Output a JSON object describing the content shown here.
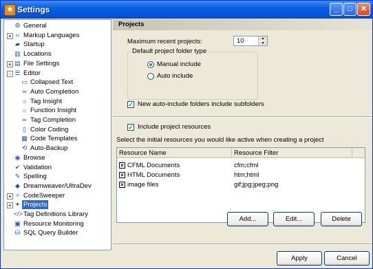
{
  "window": {
    "title": "Settings"
  },
  "tree": {
    "items": [
      {
        "label": "General",
        "icon": "settings-icon",
        "expander": ""
      },
      {
        "label": "Markup Languages",
        "icon": "code-icon",
        "expander": "+"
      },
      {
        "label": "Startup",
        "icon": "folder-icon",
        "expander": ""
      },
      {
        "label": "Locations",
        "icon": "book-icon",
        "expander": ""
      },
      {
        "label": "File Settings",
        "icon": "file-icon",
        "expander": "+"
      },
      {
        "label": "Editor",
        "icon": "editor-icon",
        "expander": "-"
      },
      {
        "label": "Collapsed Text",
        "icon": "collapse-icon",
        "expander": ""
      },
      {
        "label": "Auto Completion",
        "icon": "glasses-icon",
        "expander": ""
      },
      {
        "label": "Tag Insight",
        "icon": "bulb-icon",
        "expander": ""
      },
      {
        "label": "Function Insight",
        "icon": "bulb-icon",
        "expander": ""
      },
      {
        "label": "Tag Completion",
        "icon": "glasses-icon",
        "expander": ""
      },
      {
        "label": "Color Coding",
        "icon": "document-icon",
        "expander": ""
      },
      {
        "label": "Code Templates",
        "icon": "template-icon",
        "expander": ""
      },
      {
        "label": "Auto-Backup",
        "icon": "backup-icon",
        "expander": ""
      },
      {
        "label": "Browse",
        "icon": "browse-icon",
        "expander": ""
      },
      {
        "label": "Validation",
        "icon": "validation-icon",
        "expander": ""
      },
      {
        "label": "Spelling",
        "icon": "spelling-icon",
        "expander": ""
      },
      {
        "label": "Dreamweaver/UltraDev",
        "icon": "dreamweaver-icon",
        "expander": ""
      },
      {
        "label": "CodeSweeper",
        "icon": "broom-icon",
        "expander": "+"
      },
      {
        "label": "Projects",
        "icon": "projects-icon",
        "expander": "+"
      },
      {
        "label": "Tag Definitions Library",
        "icon": "tag-library-icon",
        "expander": ""
      },
      {
        "label": "Resource Monitoring",
        "icon": "monitor-icon",
        "expander": ""
      },
      {
        "label": "SQL Query Builder",
        "icon": "sql-icon",
        "expander": ""
      }
    ],
    "selected": "Projects"
  },
  "panel": {
    "header": "Projects",
    "max_recent_label": "Maximum recent projects:",
    "max_recent_value": "10",
    "default_type_title": "Default project folder type",
    "radio_manual": "Manual include",
    "radio_auto": "Auto include",
    "radio_selected": "manual",
    "new_auto_include_label": "New auto-include folders include subfolders",
    "new_auto_include_checked": true,
    "include_resources_label": "Include project resources",
    "include_resources_checked": true,
    "select_resources_text": "Select the initial resources you would like active when creating a project",
    "columns": [
      "Resource Name",
      "Resource Filter"
    ],
    "resources": [
      {
        "name": "CFML Documents",
        "filter": "cfm;cfml",
        "checked": true
      },
      {
        "name": "HTML Documents",
        "filter": "htm;html",
        "checked": true
      },
      {
        "name": "image files",
        "filter": "gif;jpg;jpeg;png",
        "checked": true
      }
    ],
    "add_label": "Add...",
    "edit_label": "Edit...",
    "delete_label": "Delete"
  },
  "footer": {
    "apply_label": "Apply",
    "cancel_label": "Cancel"
  },
  "colors": {
    "selection": "#316ac5",
    "titlebar": "#0554d8"
  }
}
